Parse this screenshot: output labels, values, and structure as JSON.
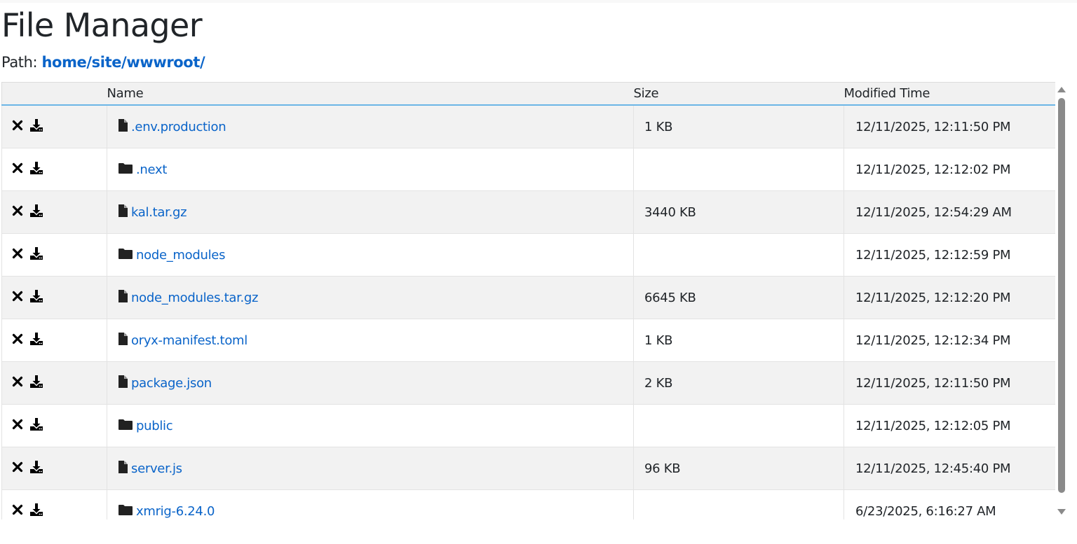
{
  "page": {
    "title": "File Manager",
    "path_label": "Path:",
    "path_value": "home/site/wwwroot/"
  },
  "table": {
    "headers": {
      "actions": "",
      "name": "Name",
      "size": "Size",
      "modified": "Modified Time"
    },
    "rows": [
      {
        "type": "file",
        "icon": "file-icon",
        "name": ".env.production",
        "size": "1 KB",
        "modified": "12/11/2025, 12:11:50 PM"
      },
      {
        "type": "folder",
        "icon": "folder-icon",
        "name": ".next",
        "size": "",
        "modified": "12/11/2025, 12:12:02 PM"
      },
      {
        "type": "file",
        "icon": "file-icon",
        "name": "kal.tar.gz",
        "size": "3440 KB",
        "modified": "12/11/2025, 12:54:29 AM"
      },
      {
        "type": "folder",
        "icon": "folder-icon",
        "name": "node_modules",
        "size": "",
        "modified": "12/11/2025, 12:12:59 PM"
      },
      {
        "type": "file",
        "icon": "file-icon",
        "name": "node_modules.tar.gz",
        "size": "6645 KB",
        "modified": "12/11/2025, 12:12:20 PM"
      },
      {
        "type": "file",
        "icon": "file-icon",
        "name": "oryx-manifest.toml",
        "size": "1 KB",
        "modified": "12/11/2025, 12:12:34 PM"
      },
      {
        "type": "file",
        "icon": "file-icon",
        "name": "package.json",
        "size": "2 KB",
        "modified": "12/11/2025, 12:11:50 PM"
      },
      {
        "type": "folder",
        "icon": "folder-icon",
        "name": "public",
        "size": "",
        "modified": "12/11/2025, 12:12:05 PM"
      },
      {
        "type": "file",
        "icon": "file-icon",
        "name": "server.js",
        "size": "96 KB",
        "modified": "12/11/2025, 12:45:40 PM"
      },
      {
        "type": "folder",
        "icon": "folder-icon",
        "name": "xmrig-6.24.0",
        "size": "",
        "modified": "6/23/2025, 6:16:27 AM"
      }
    ],
    "row_actions": {
      "delete_icon": "delete-icon",
      "download_icon": "download-icon"
    }
  },
  "colors": {
    "link": "#0a64c9",
    "header_bg": "#f1f1f1",
    "header_border": "#6cb6e6",
    "row_stripe": "#f2f2f2",
    "scrollbar": "#8a8a8a"
  }
}
